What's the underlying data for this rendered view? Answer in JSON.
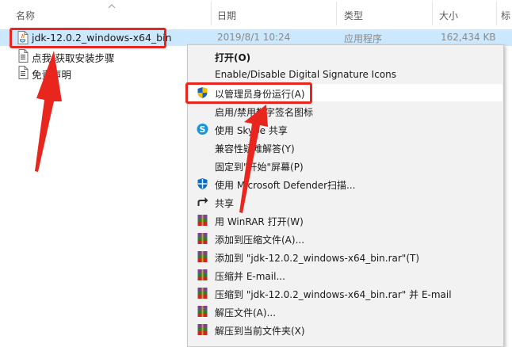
{
  "columns": {
    "name": "名称",
    "date": "日期",
    "type": "类型",
    "size": "大小",
    "tag": "标"
  },
  "files": [
    {
      "name": "jdk-12.0.2_windows-x64_bin",
      "date": "2019/8/1 10:24",
      "type": "应用程序",
      "size": "162,434 KB",
      "icon": "java-installer-icon"
    },
    {
      "name": "点我-获取安装步骤",
      "icon": "text-file-icon"
    },
    {
      "name": "免责声明",
      "icon": "text-file-icon"
    }
  ],
  "menu": {
    "items": [
      {
        "label": "打开(O)",
        "icon": "",
        "bold": true
      },
      {
        "label": "Enable/Disable Digital Signature Icons",
        "icon": ""
      },
      {
        "label": "以管理员身份运行(A)",
        "icon": "uac-shield-icon"
      },
      {
        "label": "启用/禁用数字签名图标",
        "icon": ""
      },
      {
        "label": "使用 Skype 共享",
        "icon": "skype-icon"
      },
      {
        "label": "兼容性疑难解答(Y)",
        "icon": ""
      },
      {
        "label": "固定到\"开始\"屏幕(P)",
        "icon": ""
      },
      {
        "label": "使用 Microsoft Defender扫描...",
        "icon": "defender-icon"
      },
      {
        "label": "共享",
        "icon": "share-icon"
      },
      {
        "label": "用 WinRAR 打开(W)",
        "icon": "winrar-icon"
      },
      {
        "label": "添加到压缩文件(A)...",
        "icon": "winrar-icon"
      },
      {
        "label": "添加到 \"jdk-12.0.2_windows-x64_bin.rar\"(T)",
        "icon": "winrar-icon"
      },
      {
        "label": "压缩并 E-mail...",
        "icon": "winrar-icon"
      },
      {
        "label": "压缩到 \"jdk-12.0.2_windows-x64_bin.rar\" 并 E-mail",
        "icon": "winrar-icon"
      },
      {
        "label": "解压文件(A)...",
        "icon": "winrar-icon"
      },
      {
        "label": "解压到当前文件夹(X)",
        "icon": "winrar-icon"
      }
    ]
  },
  "colors": {
    "selection": "#cce8ff",
    "annotation": "#e8261e",
    "menu_bg": "#f2f2f2"
  }
}
